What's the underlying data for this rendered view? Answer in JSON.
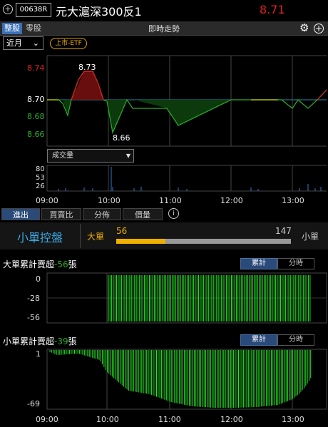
{
  "header": {
    "code": "00638R",
    "name": "元大滬深300反1",
    "price": "8.71"
  },
  "tabs": [
    {
      "label": "整股"
    },
    {
      "label": "零股"
    }
  ],
  "chart_title": "即時走勢",
  "period": "近月",
  "badge": "上市-ETF",
  "price_chart": {
    "y_ticks": [
      "8.74",
      "8.70",
      "8.68",
      "8.66"
    ],
    "high_label": "8.73",
    "low_label": "8.66",
    "volume_label": "成交量",
    "vol_ticks": [
      "80",
      "53",
      "26"
    ],
    "x_ticks": [
      "09:00",
      "10:00",
      "11:00",
      "12:00",
      "13:00"
    ]
  },
  "bottom_tabs": [
    "進出",
    "買賣比",
    "分佈",
    "價量"
  ],
  "control": {
    "title": "小單控盤",
    "big_label": "大單",
    "big_value": "56",
    "small_value": "147",
    "small_label": "小單",
    "big_ratio": 0.28
  },
  "panel1": {
    "title_prefix": "大單累計賣超",
    "value": "-56",
    "unit": "張",
    "y_ticks": [
      "0",
      "-28",
      "-56"
    ],
    "seg": [
      "累計",
      "分時"
    ]
  },
  "panel2": {
    "title_prefix": "小單累計賣超",
    "value": "-39",
    "unit": "張",
    "y_ticks": [
      "1",
      "-69"
    ],
    "seg": [
      "累計",
      "分時"
    ]
  },
  "chart_data": [
    {
      "type": "line",
      "title": "即時走勢",
      "x": [
        "09:00",
        "09:05",
        "09:15",
        "09:25",
        "09:35",
        "09:45",
        "09:55",
        "10:05",
        "10:15",
        "10:25",
        "10:35",
        "10:50",
        "11:00",
        "11:15",
        "11:30",
        "11:45",
        "12:00",
        "12:15",
        "12:30",
        "12:45",
        "13:00",
        "13:10",
        "13:20",
        "13:30"
      ],
      "values": [
        8.7,
        8.69,
        8.7,
        8.73,
        8.73,
        8.7,
        8.69,
        8.66,
        8.69,
        8.69,
        8.69,
        8.69,
        8.675,
        8.68,
        8.685,
        8.69,
        8.7,
        8.7,
        8.7,
        8.69,
        8.7,
        8.69,
        8.7,
        8.71
      ],
      "reference": 8.7,
      "ylim": [
        8.65,
        8.75
      ]
    },
    {
      "type": "bar",
      "title": "成交量",
      "yticks": [
        26,
        53,
        80
      ],
      "note": "volume bars, peak near 10:00"
    },
    {
      "type": "bar",
      "title": "大單累計賣超",
      "ylim": [
        -56,
        0
      ],
      "final": -56
    },
    {
      "type": "bar",
      "title": "小單累計賣超",
      "ylim": [
        -69,
        1
      ],
      "final": -39
    }
  ]
}
